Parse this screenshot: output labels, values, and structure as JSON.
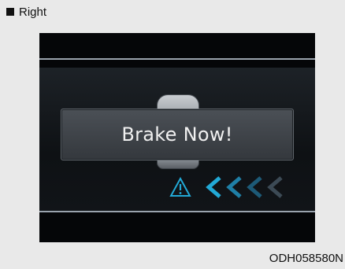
{
  "header": {
    "label": "Right"
  },
  "display": {
    "message": "Brake Now!"
  },
  "icons": {
    "warning": "warning-triangle-icon",
    "direction": "left-chevrons-icon"
  },
  "caption": "ODH058580N",
  "colors": {
    "accent_blue": "#22a9d6",
    "screen_bg": "#050608",
    "panel_bg": "#e9e9e9"
  }
}
